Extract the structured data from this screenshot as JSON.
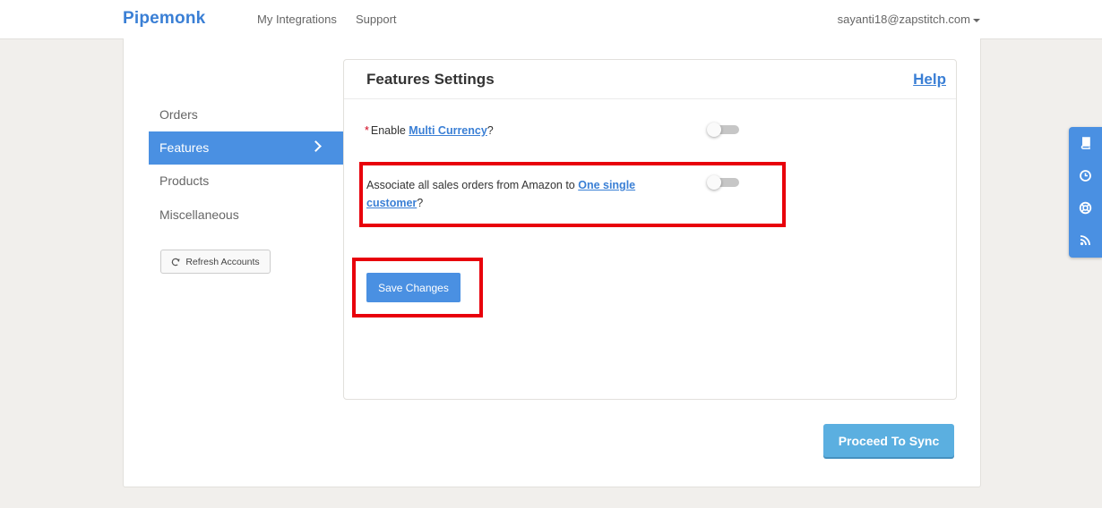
{
  "header": {
    "brand": "Pipemonk",
    "nav": [
      "My Integrations",
      "Support"
    ],
    "user_email": "sayanti18@zapstitch.com"
  },
  "sidebar": {
    "items": [
      {
        "label": "Orders",
        "active": false
      },
      {
        "label": "Features",
        "active": true
      },
      {
        "label": "Products",
        "active": false
      },
      {
        "label": "Miscellaneous",
        "active": false
      }
    ],
    "refresh_label": "Refresh Accounts"
  },
  "panel": {
    "title": "Features Settings",
    "help_label": "Help",
    "settings": [
      {
        "required": "*",
        "prefix": "Enable ",
        "link": "Multi Currency",
        "suffix": "?",
        "enabled": false
      },
      {
        "prefix": "Associate all sales orders from Amazon to ",
        "link": "One single customer",
        "suffix": "?",
        "enabled": false
      }
    ],
    "save_label": "Save Changes"
  },
  "proceed_label": "Proceed To Sync",
  "float_bar_icons": [
    "book-icon",
    "clock-icon",
    "lifebuoy-icon",
    "rss-icon"
  ],
  "colors": {
    "accent": "#4a90e2",
    "brand": "#3a7fd5",
    "proceed": "#5bafe0",
    "highlight": "#e8000b"
  }
}
